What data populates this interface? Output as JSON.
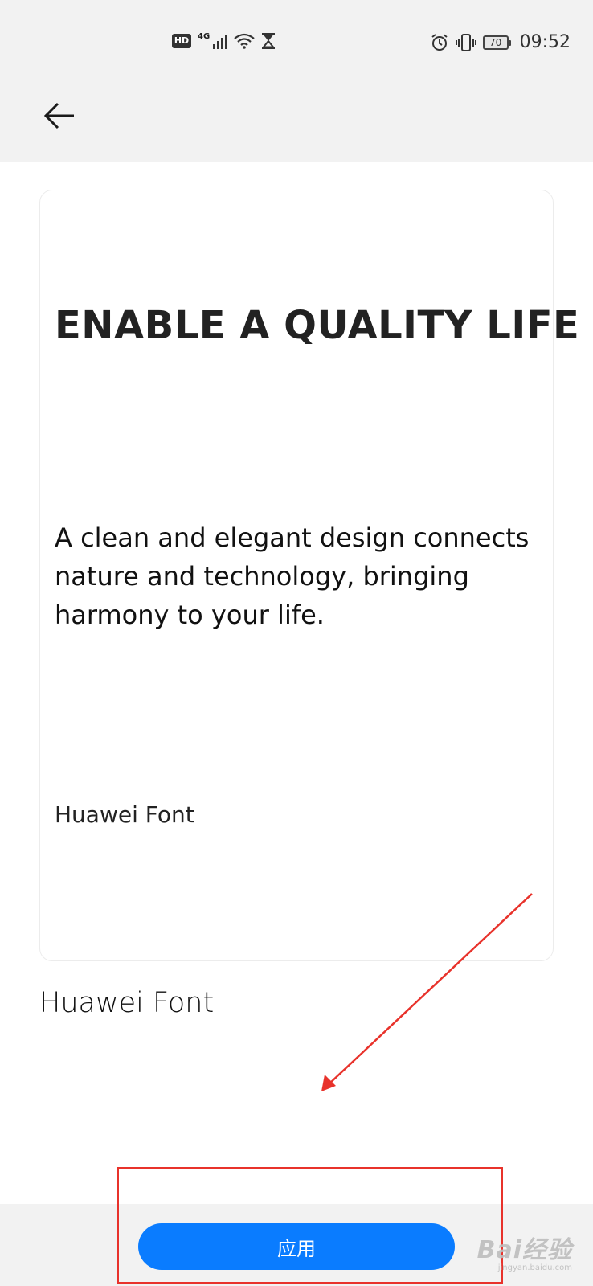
{
  "status_bar": {
    "hd": "HD",
    "network": "4G",
    "battery": "70",
    "time": "09:52",
    "icons": [
      "hd-badge",
      "signal-icon",
      "wifi-icon",
      "hourglass-icon",
      "alarm-icon",
      "vibrate-icon",
      "battery-icon"
    ]
  },
  "header": {
    "back_icon": "back-arrow-icon"
  },
  "preview": {
    "headline": "ENABLE A QUALITY LIFE",
    "body": "A clean and elegant design connects nature and technology, bringing harmony to your life.",
    "footer": "Huawei Font"
  },
  "font_name": "Huawei Font",
  "apply_button": {
    "label": "应用"
  },
  "annotation": {
    "color": "#e8322b"
  },
  "watermark": {
    "main": "Bai经验",
    "sub": "jingyan.baidu.com"
  },
  "colors": {
    "primary": "#0a7cff",
    "bar_background": "#f2f2f2",
    "annotation": "#e8322b"
  }
}
